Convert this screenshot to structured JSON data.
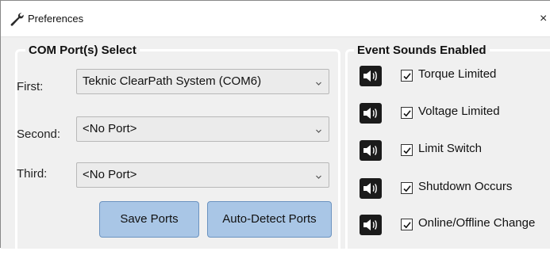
{
  "window": {
    "title": "Preferences",
    "close_glyph": "×"
  },
  "com_group": {
    "legend": "COM Port(s) Select",
    "rows": [
      {
        "label": "First:",
        "value": "Teknic ClearPath System (COM6)"
      },
      {
        "label": "Second:",
        "value": "<No Port>"
      },
      {
        "label": "Third:",
        "value": "<No Port>"
      }
    ],
    "save_button": "Save Ports",
    "auto_button": "Auto-Detect Ports"
  },
  "sound_group": {
    "legend": "Event Sounds Enabled",
    "items": [
      {
        "label": "Torque Limited",
        "checked": true
      },
      {
        "label": "Voltage Limited",
        "checked": true
      },
      {
        "label": "Limit Switch",
        "checked": true
      },
      {
        "label": "Shutdown Occurs",
        "checked": true
      },
      {
        "label": "Online/Offline Change",
        "checked": true
      }
    ]
  },
  "icons": {
    "title": "wrench-icon",
    "speaker": "speaker-icon",
    "checkmark": "checkmark-icon",
    "dropdown": "chevron-down-icon"
  },
  "colors": {
    "button_fill": "#a9c6e6",
    "button_border": "#6b93c0",
    "background": "#f0f0f0"
  }
}
